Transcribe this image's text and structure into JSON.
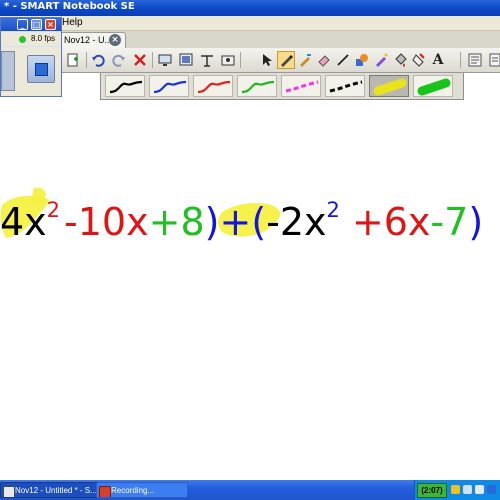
{
  "window": {
    "title": "* - SMART Notebook SE"
  },
  "menu": {
    "help": "Help"
  },
  "tab": {
    "label": "Nov12 - U..."
  },
  "recorder": {
    "fps": "8.0 fps"
  },
  "toolbar": {
    "icons": [
      "insert-page-icon",
      "undo-icon",
      "redo-icon",
      "delete-icon",
      "screen-shade-icon",
      "full-screen-icon",
      "table-icon",
      "select-icon",
      "pen-icon",
      "creative-pen-icon",
      "eraser-icon",
      "line-icon",
      "shape-icon",
      "magic-pen-icon",
      "fill-icon",
      "text-icon",
      "properties-icon"
    ]
  },
  "pens": {
    "colors": [
      "#000000",
      "#1733e8",
      "#e62020",
      "#1fb81f",
      "#ff2ee0",
      "#000000",
      "#e9e31c",
      "#19c419"
    ],
    "selected_index": 6
  },
  "equation": {
    "t1_coef": "4x",
    "t1_exp": "2",
    "t2": "-10x",
    "t3": "+8",
    "close1": ")",
    "plus": "+",
    "open2": "(",
    "t4_coef": "-2x",
    "t4_exp": "2",
    "t5": "+6x",
    "t6": "-7",
    "close2": ")",
    "colors": {
      "black": "#000000",
      "red": "#e01414",
      "green": "#1fc01f",
      "blue": "#1414e0",
      "highlight": "#f4ef3a"
    }
  },
  "taskbar": {
    "items": [
      {
        "label": "Nov12 - Untitled * - S..."
      },
      {
        "label": "Recording..."
      }
    ],
    "clock": "(2:07)"
  }
}
